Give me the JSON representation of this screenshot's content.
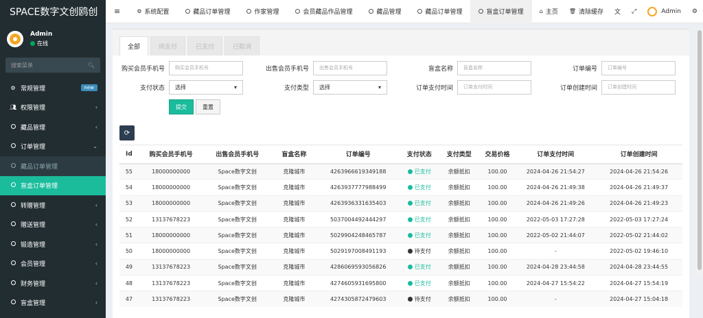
{
  "app": {
    "title": "SPACE数字文创鸥创"
  },
  "user": {
    "name": "Admin",
    "status": "在线"
  },
  "sidebar": {
    "search_placeholder": "搜索菜单",
    "items": [
      {
        "label": "常规管理",
        "badge": "new"
      },
      {
        "label": "权限管理"
      },
      {
        "label": "藏品管理"
      },
      {
        "label": "订单管理",
        "expanded": true
      },
      {
        "label": "藏品订单管理",
        "sub": true
      },
      {
        "label": "盲盒订单管理",
        "sub": true,
        "active": true
      },
      {
        "label": "转赠管理"
      },
      {
        "label": "赠送管理"
      },
      {
        "label": "锻造管理"
      },
      {
        "label": "会员管理"
      },
      {
        "label": "财务管理"
      },
      {
        "label": "盲盒管理"
      }
    ]
  },
  "topnav": {
    "items": [
      {
        "label": "系统配置"
      },
      {
        "label": "藏品订单管理"
      },
      {
        "label": "作家管理"
      },
      {
        "label": "会员藏品作品管理"
      },
      {
        "label": "藏品管理"
      },
      {
        "label": "藏品订单管理"
      },
      {
        "label": "盲盒订单管理",
        "active": true
      }
    ],
    "home": "主页",
    "clear_cache": "清除缓存",
    "admin": "Admin"
  },
  "tabs": [
    "全部",
    "待支付",
    "已支付",
    "已取消"
  ],
  "filters": {
    "buyer_phone": {
      "label": "购买会员手机号",
      "placeholder": "购买会员手机号"
    },
    "seller_phone": {
      "label": "出售会员手机号",
      "placeholder": "出售会员手机号"
    },
    "box_name": {
      "label": "盲盒名称",
      "placeholder": "盲盒名称"
    },
    "order_no": {
      "label": "订单编号",
      "placeholder": "订单编号"
    },
    "pay_status": {
      "label": "支付状态",
      "value": "选择"
    },
    "pay_type": {
      "label": "支付类型",
      "value": "选择"
    },
    "pay_time": {
      "label": "订单支付时间",
      "placeholder": "订单支付时间"
    },
    "create_time": {
      "label": "订单创建时间",
      "placeholder": "订单创建时间"
    }
  },
  "buttons": {
    "submit": "提交",
    "reset": "重置"
  },
  "table": {
    "columns": [
      "Id",
      "购买会员手机号",
      "出售会员手机号",
      "盲盒名称",
      "订单编号",
      "支付状态",
      "支付类型",
      "交易价格",
      "订单支付时间",
      "订单创建时间"
    ],
    "rows": [
      {
        "id": "55",
        "buyer": "18000000000",
        "seller": "Space数字文创",
        "box": "克隆城市",
        "order": "4263966619349188",
        "status": "已支付",
        "paid": true,
        "type": "余额抵扣",
        "price": "100.00",
        "pay_time": "2024-04-26 21:54:27",
        "create_time": "2024-04-26 21:54:26"
      },
      {
        "id": "54",
        "buyer": "18000000000",
        "seller": "Space数字文创",
        "box": "克隆城市",
        "order": "4263937777988499",
        "status": "已支付",
        "paid": true,
        "type": "余额抵扣",
        "price": "100.00",
        "pay_time": "2024-04-26 21:49:38",
        "create_time": "2024-04-26 21:49:37"
      },
      {
        "id": "53",
        "buyer": "18000000000",
        "seller": "Space数字文创",
        "box": "克隆城市",
        "order": "4263936331635403",
        "status": "已支付",
        "paid": true,
        "type": "余额抵扣",
        "price": "100.00",
        "pay_time": "2024-04-26 21:49:26",
        "create_time": "2024-04-26 21:49:23"
      },
      {
        "id": "52",
        "buyer": "13137678223",
        "seller": "Space数字文创",
        "box": "克隆城市",
        "order": "5037004492444297",
        "status": "已支付",
        "paid": true,
        "type": "余额抵扣",
        "price": "100.00",
        "pay_time": "2022-05-03 17:27:28",
        "create_time": "2022-05-03 17:27:24"
      },
      {
        "id": "51",
        "buyer": "18000000000",
        "seller": "Space数字文创",
        "box": "克隆城市",
        "order": "5029904248465787",
        "status": "已支付",
        "paid": true,
        "type": "余额抵扣",
        "price": "100.00",
        "pay_time": "2022-05-02 21:44:07",
        "create_time": "2022-05-02 21:44:02"
      },
      {
        "id": "50",
        "buyer": "18000000000",
        "seller": "Space数字文创",
        "box": "克隆城市",
        "order": "5029197008491193",
        "status": "待支付",
        "paid": false,
        "type": "余额抵扣",
        "price": "100.00",
        "pay_time": "-",
        "create_time": "2022-05-02 19:46:10"
      },
      {
        "id": "49",
        "buyer": "13137678223",
        "seller": "Space数字文创",
        "box": "克隆城市",
        "order": "4286069593056826",
        "status": "已支付",
        "paid": true,
        "type": "余额抵扣",
        "price": "100.00",
        "pay_time": "2024-04-28 23:44:58",
        "create_time": "2024-04-28 23:44:55"
      },
      {
        "id": "48",
        "buyer": "13137678223",
        "seller": "Space数字文创",
        "box": "克隆城市",
        "order": "4274605931695800",
        "status": "已支付",
        "paid": true,
        "type": "余额抵扣",
        "price": "100.00",
        "pay_time": "2024-04-27 15:54:22",
        "create_time": "2024-04-27 15:54:19"
      },
      {
        "id": "47",
        "buyer": "13137678223",
        "seller": "Space数字文创",
        "box": "克隆城市",
        "order": "4274305872479603",
        "status": "待支付",
        "paid": false,
        "type": "余额抵扣",
        "price": "100.00",
        "pay_time": "-",
        "create_time": "2024-04-27 15:04:18"
      }
    ]
  },
  "colors": {
    "sidebar_bg": "#222d32",
    "accent": "#1abc9c",
    "paid": "#18bc9c"
  }
}
